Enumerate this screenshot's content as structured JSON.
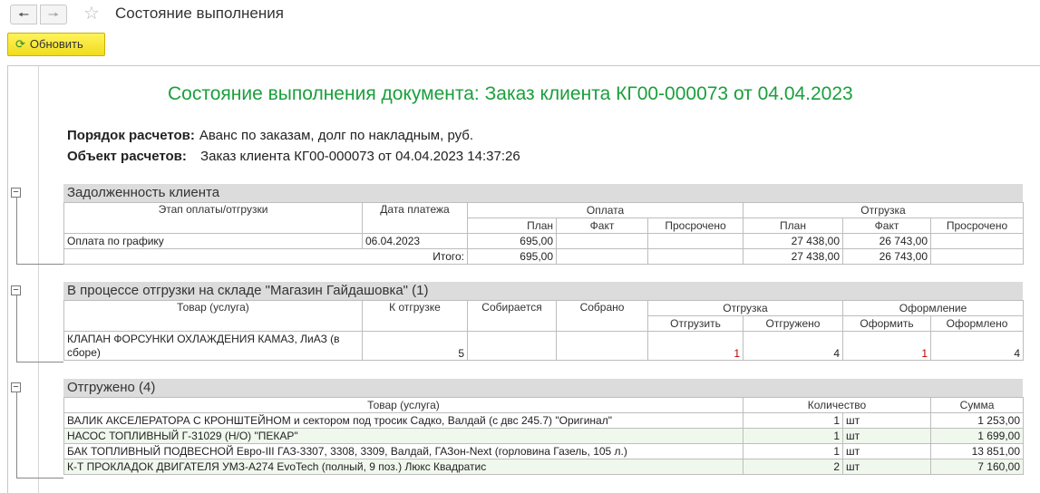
{
  "window": {
    "title": "Состояние выполнения"
  },
  "toolbar": {
    "refresh_label": "Обновить"
  },
  "report": {
    "title": "Состояние выполнения документа: Заказ клиента КГ00-000073 от 04.04.2023",
    "settlement_order_label": "Порядок расчетов:",
    "settlement_order_value": "Аванс по заказам, долг по накладным, руб.",
    "settlement_object_label": "Объект расчетов:",
    "settlement_object_value": "Заказ клиента КГ00-000073 от 04.04.2023 14:37:26"
  },
  "debt": {
    "title": "Задолженность клиента",
    "headers": {
      "stage": "Этап оплаты/отгрузки",
      "pay_date": "Дата платежа",
      "payment": "Оплата",
      "shipment": "Отгрузка",
      "plan": "План",
      "fact": "Факт",
      "overdue": "Просрочено"
    },
    "row": {
      "stage": "Оплата по графику",
      "pay_date": "06.04.2023",
      "pay_plan": "695,00",
      "pay_fact": "",
      "pay_overdue": "",
      "ship_plan": "27 438,00",
      "ship_fact": "26 743,00",
      "ship_overdue": ""
    },
    "total": {
      "label": "Итого:",
      "pay_plan": "695,00",
      "pay_fact": "",
      "pay_overdue": "",
      "ship_plan": "27 438,00",
      "ship_fact": "26 743,00",
      "ship_overdue": ""
    }
  },
  "in_process": {
    "title": "В процессе отгрузки на складе \"Магазин Гайдашовка\" (1)",
    "headers": {
      "item": "Товар (услуга)",
      "to_ship": "К отгрузке",
      "collecting": "Собирается",
      "collected": "Собрано",
      "shipment": "Отгрузка",
      "ship": "Отгрузить",
      "shipped": "Отгружено",
      "formalization": "Оформление",
      "formalize": "Оформить",
      "formalized": "Оформлено"
    },
    "row": {
      "item": "КЛАПАН ФОРСУНКИ ОХЛАЖДЕНИЯ КАМАЗ, ЛиАЗ (в сборе)",
      "to_ship": "5",
      "collecting": "",
      "collected": "",
      "ship": "1",
      "shipped": "4",
      "formalize": "1",
      "formalized": "4"
    }
  },
  "shipped": {
    "title": "Отгружено (4)",
    "headers": {
      "item": "Товар (услуга)",
      "qty": "Количество",
      "sum": "Сумма"
    },
    "rows": [
      {
        "item": "ВАЛИК АКСЕЛЕРАТОРА С КРОНШТЕЙНОМ и сектором под тросик Садко, Валдай (с двс 245.7) \"Оригинал\"",
        "qty": "1",
        "unit": "шт",
        "sum": "1 253,00"
      },
      {
        "item": "НАСОС ТОПЛИВНЫЙ Г-31029 (Н/О) \"ПЕКАР\"",
        "qty": "1",
        "unit": "шт",
        "sum": "1 699,00"
      },
      {
        "item": "БАК ТОПЛИВНЫЙ ПОДВЕСНОЙ Евро-III ГАЗ-3307, 3308, 3309, Валдай, ГАЗон-Next (горловина Газель, 105 л.)",
        "qty": "1",
        "unit": "шт",
        "sum": "13 851,00"
      },
      {
        "item": "К-Т ПРОКЛАДОК ДВИГАТЕЛЯ УМЗ-А274 EvoTech (полный, 9 поз.) Люкс Квадратис",
        "qty": "2",
        "unit": "шт",
        "sum": "7 160,00"
      }
    ]
  }
}
